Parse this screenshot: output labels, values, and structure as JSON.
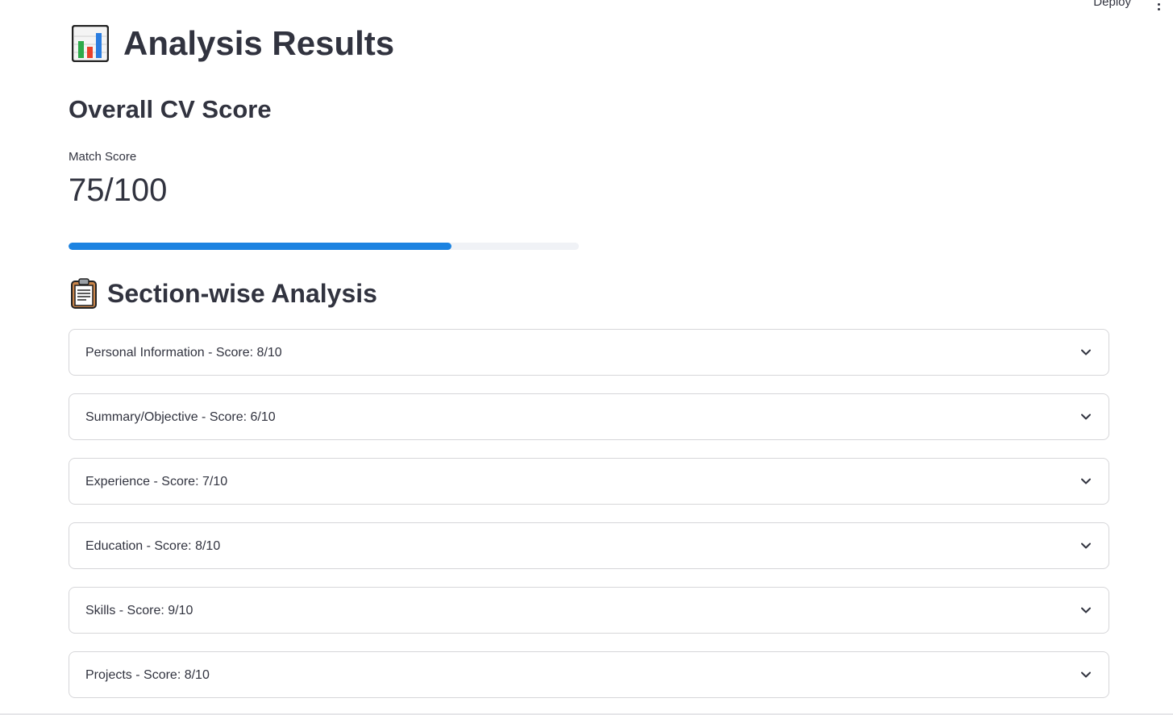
{
  "header": {
    "deploy_label": "Deploy",
    "menu_icon": "more-vertical-icon"
  },
  "main": {
    "title": "Analysis Results",
    "title_icon": "bar-chart-emoji-icon",
    "overall_heading": "Overall CV Score",
    "metric": {
      "label": "Match Score",
      "value": "75/100"
    },
    "progress": {
      "value": 0.75,
      "fill_color": "#1c83e1",
      "track_color": "#f0f2f6"
    },
    "section_heading": "Section-wise Analysis",
    "section_icon": "clipboard-emoji-icon",
    "sections": [
      {
        "label": "Personal Information - Score: 8/10"
      },
      {
        "label": "Summary/Objective - Score: 6/10"
      },
      {
        "label": "Experience - Score: 7/10"
      },
      {
        "label": "Education - Score: 8/10"
      },
      {
        "label": "Skills - Score: 9/10"
      },
      {
        "label": "Projects - Score: 8/10"
      }
    ]
  }
}
